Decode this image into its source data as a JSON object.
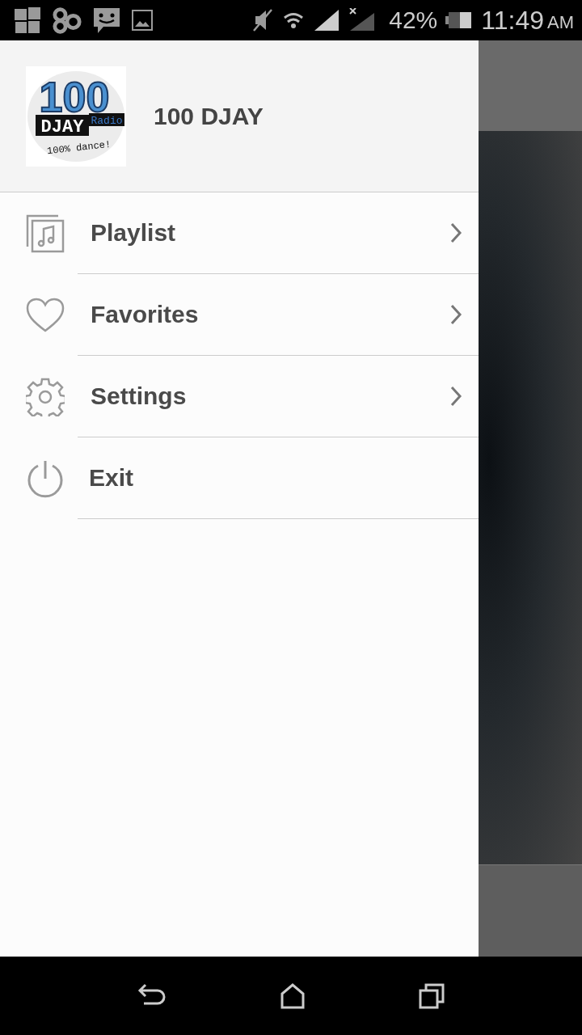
{
  "status_bar": {
    "battery": "42%",
    "time": "11:49",
    "meridiem": "AM"
  },
  "header": {
    "title": "100 DJAY",
    "logo": {
      "number": "100",
      "name": "DJAY",
      "tag": "Radio",
      "slogan": "100% dance!"
    }
  },
  "menu": [
    {
      "kind": "playlist",
      "label": "Playlist",
      "has_arrow": true
    },
    {
      "kind": "favorites",
      "label": "Favorites",
      "has_arrow": true
    },
    {
      "kind": "settings",
      "label": "Settings",
      "has_arrow": true
    },
    {
      "kind": "exit",
      "label": "Exit",
      "has_arrow": false
    }
  ]
}
